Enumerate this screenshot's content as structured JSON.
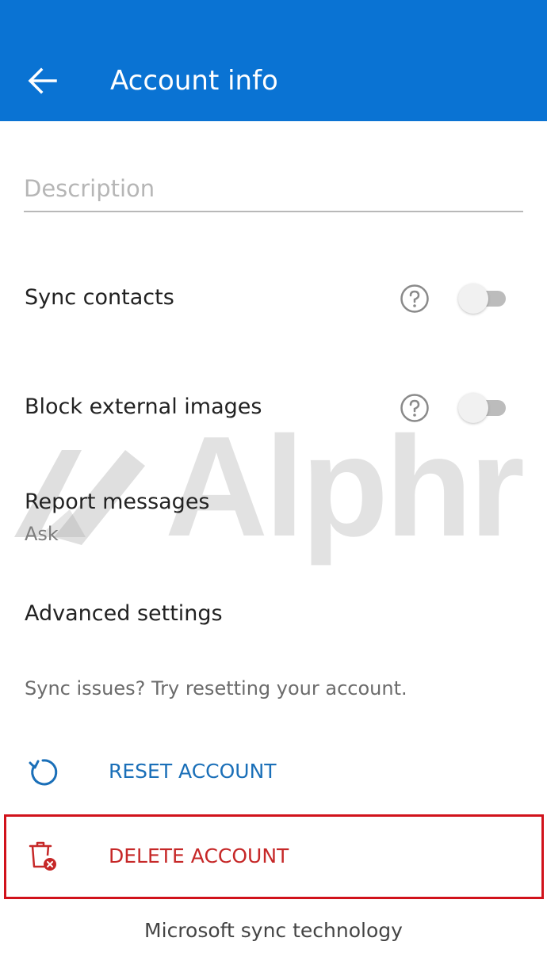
{
  "app_bar": {
    "title": "Account info",
    "background": "#0a73d3",
    "back_icon": "arrow-left-icon"
  },
  "description": {
    "placeholder": "Description",
    "value": ""
  },
  "settings": {
    "sync_contacts": {
      "label": "Sync contacts",
      "enabled": false,
      "help_icon": "question-circle-icon"
    },
    "block_external_images": {
      "label": "Block external images",
      "enabled": false,
      "help_icon": "question-circle-icon"
    },
    "report_messages": {
      "label": "Report messages",
      "value": "Ask"
    },
    "advanced_settings": {
      "label": "Advanced settings"
    }
  },
  "hint": "Sync issues? Try resetting your account.",
  "actions": {
    "reset": {
      "label": "RESET ACCOUNT",
      "icon": "refresh-icon",
      "color": "#1a6fb8"
    },
    "delete": {
      "label": "DELETE ACCOUNT",
      "icon": "trash-x-icon",
      "color": "#c62828"
    }
  },
  "footer": "Microsoft sync technology",
  "watermark": {
    "text": "Alphr",
    "icon": "alphr-logo-icon"
  },
  "colors": {
    "highlight_box": "#d1121b"
  }
}
